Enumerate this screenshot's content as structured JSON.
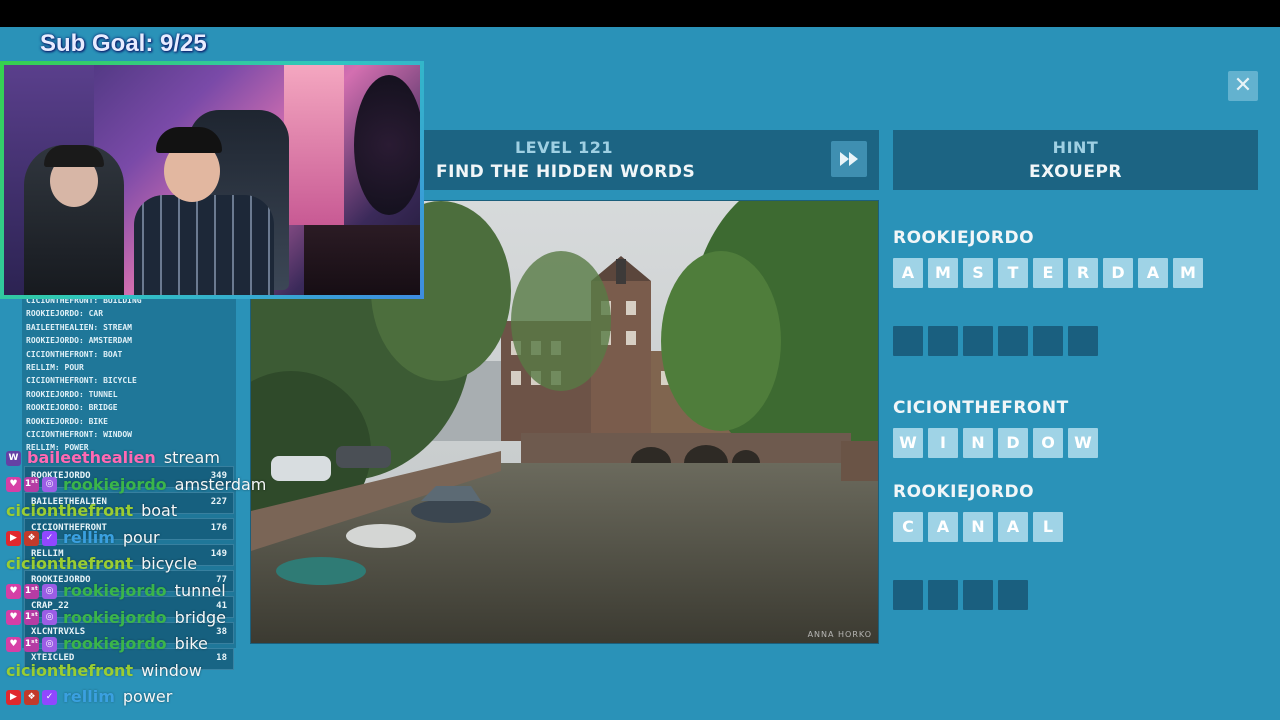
{
  "overlay": {
    "sub_goal": "Sub Goal: 9/25"
  },
  "game": {
    "level_number": "LEVEL 121",
    "level_title": "FIND THE HIDDEN WORDS",
    "skip_icon": "fast-forward-icon",
    "close_icon": "close-icon",
    "close_glyph": "✕",
    "hint_label": "HINT",
    "hint_value": "EXOUEPR",
    "photo_credit": "ANNA HORKO",
    "words": [
      {
        "solver": "ROOKIEJORDO",
        "letters": [
          "A",
          "M",
          "S",
          "T",
          "E",
          "R",
          "D",
          "A",
          "M"
        ],
        "solved": true
      },
      {
        "solver": "",
        "letters": [
          "",
          "",
          "",
          "",
          "",
          ""
        ],
        "solved": false
      },
      {
        "solver": "CICIONTHEFRONT",
        "letters": [
          "W",
          "I",
          "N",
          "D",
          "O",
          "W"
        ],
        "solved": true
      },
      {
        "solver": "ROOKIEJORDO",
        "letters": [
          "C",
          "A",
          "N",
          "A",
          "L"
        ],
        "solved": true
      },
      {
        "solver": "",
        "letters": [
          "",
          "",
          "",
          ""
        ],
        "solved": false
      }
    ]
  },
  "guess_feed": [
    "CICIONTHEFRONT: BUILDING",
    "ROOKIEJORDO: CAR",
    "BAILEETHEALIEN: STREAM",
    "ROOKIEJORDO: AMSTERDAM",
    "CICIONTHEFRONT: BOAT",
    "RELLIM: POUR",
    "CICIONTHEFRONT: BICYCLE",
    "ROOKIEJORDO: TUNNEL",
    "ROOKIEJORDO: BRIDGE",
    "ROOKIEJORDO: BIKE",
    "CICIONTHEFRONT: WINDOW",
    "RELLIM: POWER"
  ],
  "scoreboard": [
    {
      "name": "ROOKIEJORDO",
      "points": "349"
    },
    {
      "name": "BAILEETHEALIEN",
      "points": "227"
    },
    {
      "name": "CICIONTHEFRONT",
      "points": "176"
    },
    {
      "name": "RELLIM",
      "points": "149"
    },
    {
      "name": "ROOKIEJORDO",
      "points": "77"
    },
    {
      "name": "CRAP_22",
      "points": "41"
    },
    {
      "name": "XLCNTRVXLS",
      "points": "38"
    },
    {
      "name": "XTEICLED",
      "points": "18"
    }
  ],
  "chat": [
    {
      "badges": [
        "prime"
      ],
      "user": "baileethealien",
      "message": "stream",
      "color": "#ff69b4"
    },
    {
      "badges": [
        "heart",
        "sub-1st",
        "sub"
      ],
      "user": "rookiejordo",
      "message": "amsterdam",
      "color": "#3ab54a"
    },
    {
      "badges": [],
      "user": "cicionthefront",
      "message": "boat",
      "color": "#9acd32"
    },
    {
      "badges": [
        "video",
        "cheer",
        "verified"
      ],
      "user": "rellim",
      "message": "pour",
      "color": "#3aa0e0"
    },
    {
      "badges": [],
      "user": "cicionthefront",
      "message": "bicycle",
      "color": "#9acd32"
    },
    {
      "badges": [
        "heart",
        "sub-1st",
        "sub"
      ],
      "user": "rookiejordo",
      "message": "tunnel",
      "color": "#3ab54a"
    },
    {
      "badges": [
        "heart",
        "sub-1st",
        "sub"
      ],
      "user": "rookiejordo",
      "message": "bridge",
      "color": "#3ab54a"
    },
    {
      "badges": [
        "heart",
        "sub-1st",
        "sub"
      ],
      "user": "rookiejordo",
      "message": "bike",
      "color": "#3ab54a"
    },
    {
      "badges": [],
      "user": "cicionthefront",
      "message": "window",
      "color": "#9acd32"
    },
    {
      "badges": [
        "video",
        "cheer",
        "verified"
      ],
      "user": "rellim",
      "message": "power",
      "color": "#3aa0e0"
    }
  ]
}
